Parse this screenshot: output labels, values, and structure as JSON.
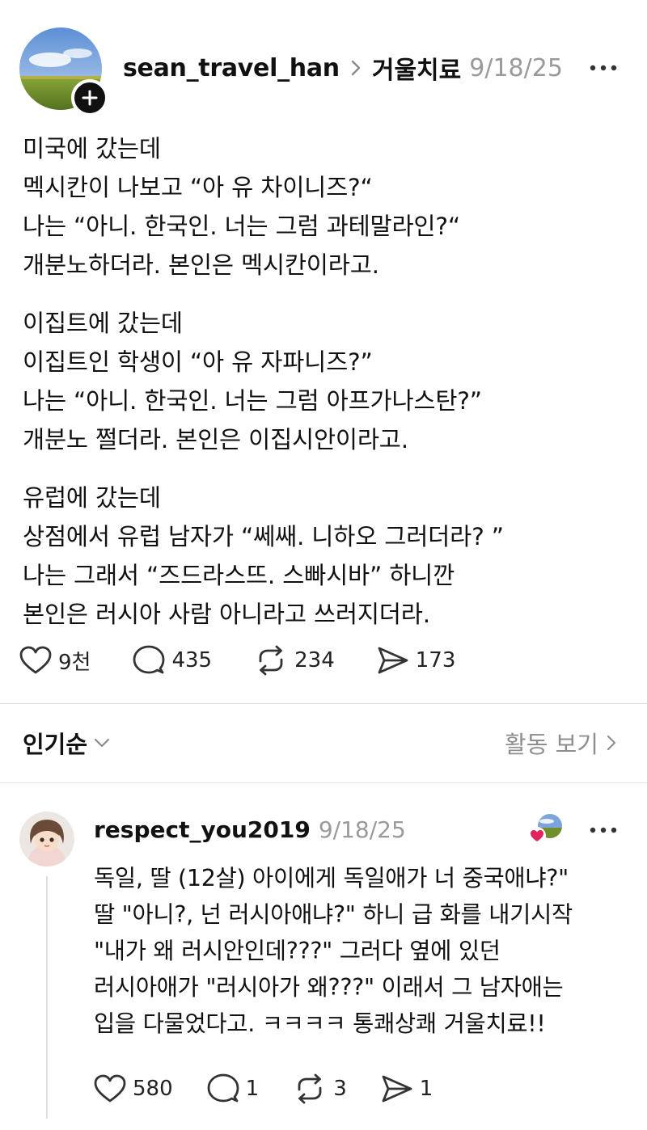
{
  "post": {
    "username": "sean_travel_han",
    "community": "거울치료",
    "date": "9/18/25",
    "body": [
      [
        "미국에 갔는데",
        "멕시칸이 나보고 “아 유 차이니즈?“",
        "나는 “아니. 한국인. 너는 그럼 과테말라인?“",
        "개분노하더라. 본인은 멕시칸이라고."
      ],
      [
        "이집트에 갔는데",
        "이집트인 학생이 “아 유 자파니즈?”",
        "나는 “아니. 한국인. 너는 그럼 아프가나스탄?”",
        "개분노 쩔더라. 본인은 이집시안이라고."
      ],
      [
        "유럽에 갔는데",
        "상점에서 유럽 남자가 “쎄쌔. 니하오 그러더라? ”",
        "나는 그래서 “즈드라스뜨. 스빠시바” 하니깐",
        "본인은 러시아 사람 아니라고 쓰러지더라."
      ]
    ],
    "likes": "9천",
    "replies": "435",
    "reposts": "234",
    "shares": "173"
  },
  "sort": {
    "label": "인기순",
    "activity_label": "활동 보기"
  },
  "comment": {
    "username": "respect_you2019",
    "date": "9/18/25",
    "body": [
      "독일, 딸 (12살) 아이에게 독일애가  너 중국애냐?\"",
      "딸 \"아니?, 넌 러시아애냐?\" 하니 급 화를 내기시작",
      "\"내가 왜 러시안인데???\" 그러다 옆에 있던",
      "러시아애가 \"러시아가 왜???\" 이래서 그 남자애는",
      "입을 다물었다고. ㅋㅋㅋㅋ  통쾌상쾌 거울치료!!"
    ],
    "likes": "580",
    "replies": "1",
    "reposts": "3",
    "shares": "1"
  },
  "icons": {
    "follow": "plus-icon",
    "like": "heart-icon",
    "reply": "speech-bubble-icon",
    "repost": "repost-arrows-icon",
    "share": "send-icon",
    "more": "more-dots-icon",
    "chevron": "chevron-right-icon",
    "sort_chevron": "chevron-down-icon"
  },
  "colors": {
    "text": "#111111",
    "muted": "#9a9a9a",
    "divider": "#e2e2e2",
    "like_heart": "#e0245e"
  }
}
